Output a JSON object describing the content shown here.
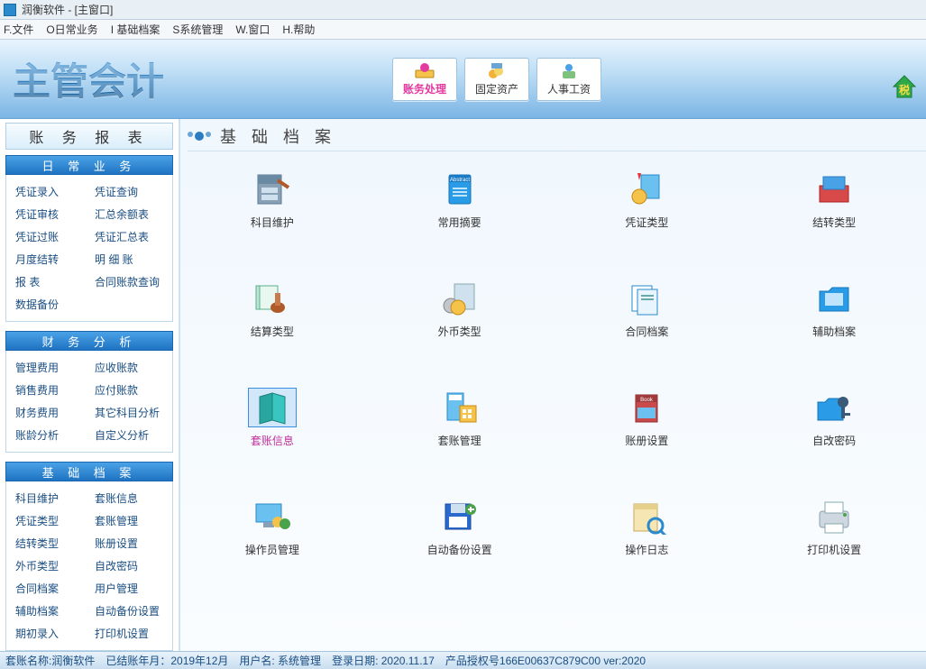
{
  "window": {
    "title": "润衡软件 - [主窗口]"
  },
  "menu": [
    "F.文件",
    "O日常业务",
    "I 基础档案",
    "S系统管理",
    "W.窗口",
    "H.帮助"
  ],
  "banner": {
    "title": "主管会计",
    "buttons": [
      {
        "label": "账务处理",
        "accent": true
      },
      {
        "label": "固定资产",
        "accent": false
      },
      {
        "label": "人事工资",
        "accent": false
      }
    ]
  },
  "sidebar": {
    "top": "账 务 报 表",
    "sections": [
      {
        "header": "日 常 业 务",
        "rows": [
          [
            "凭证录入",
            "凭证查询"
          ],
          [
            "凭证审核",
            "汇总余额表"
          ],
          [
            "凭证过账",
            "凭证汇总表"
          ],
          [
            "月度结转",
            "明 细 账"
          ],
          [
            "报    表",
            "合同账款查询"
          ],
          [
            "数据备份",
            ""
          ]
        ]
      },
      {
        "header": "财 务 分 析",
        "rows": [
          [
            "管理费用",
            "应收账款"
          ],
          [
            "销售费用",
            "应付账款"
          ],
          [
            "财务费用",
            "其它科目分析"
          ],
          [
            "账龄分析",
            "自定义分析"
          ]
        ]
      },
      {
        "header": "基 础 档 案",
        "rows": [
          [
            "科目维护",
            "套账信息"
          ],
          [
            "凭证类型",
            "套账管理"
          ],
          [
            "结转类型",
            "账册设置"
          ],
          [
            "外币类型",
            "自改密码"
          ],
          [
            "合同档案",
            "用户管理"
          ],
          [
            "辅助档案",
            "自动备份设置"
          ],
          [
            "期初录入",
            "打印机设置"
          ]
        ]
      }
    ]
  },
  "content": {
    "header": "基 础 档 案",
    "items": [
      {
        "label": "科目维护",
        "selected": false,
        "icon": "cabinet"
      },
      {
        "label": "常用摘要",
        "selected": false,
        "icon": "bluebook"
      },
      {
        "label": "凭证类型",
        "selected": false,
        "icon": "award"
      },
      {
        "label": "结转类型",
        "selected": false,
        "icon": "redbox"
      },
      {
        "label": "结算类型",
        "selected": false,
        "icon": "stamp"
      },
      {
        "label": "外币类型",
        "selected": false,
        "icon": "coins"
      },
      {
        "label": "合同档案",
        "selected": false,
        "icon": "contract"
      },
      {
        "label": "辅助档案",
        "selected": false,
        "icon": "bluefolder"
      },
      {
        "label": "套账信息",
        "selected": true,
        "icon": "tealbook"
      },
      {
        "label": "套账管理",
        "selected": false,
        "icon": "calc"
      },
      {
        "label": "账册设置",
        "selected": false,
        "icon": "book"
      },
      {
        "label": "自改密码",
        "selected": false,
        "icon": "keyfolder"
      },
      {
        "label": "操作员管理",
        "selected": false,
        "icon": "users"
      },
      {
        "label": "自动备份设置",
        "selected": false,
        "icon": "floppy"
      },
      {
        "label": "操作日志",
        "selected": false,
        "icon": "log"
      },
      {
        "label": "打印机设置",
        "selected": false,
        "icon": "printer"
      }
    ]
  },
  "status": {
    "account": "套账名称:润衡软件",
    "period": "已结账年月：2019年12月",
    "user": "用户名: 系统管理",
    "login": "登录日期: 2020.11.17",
    "license": "产品授权号166E00637C879C00 ver:2020"
  }
}
